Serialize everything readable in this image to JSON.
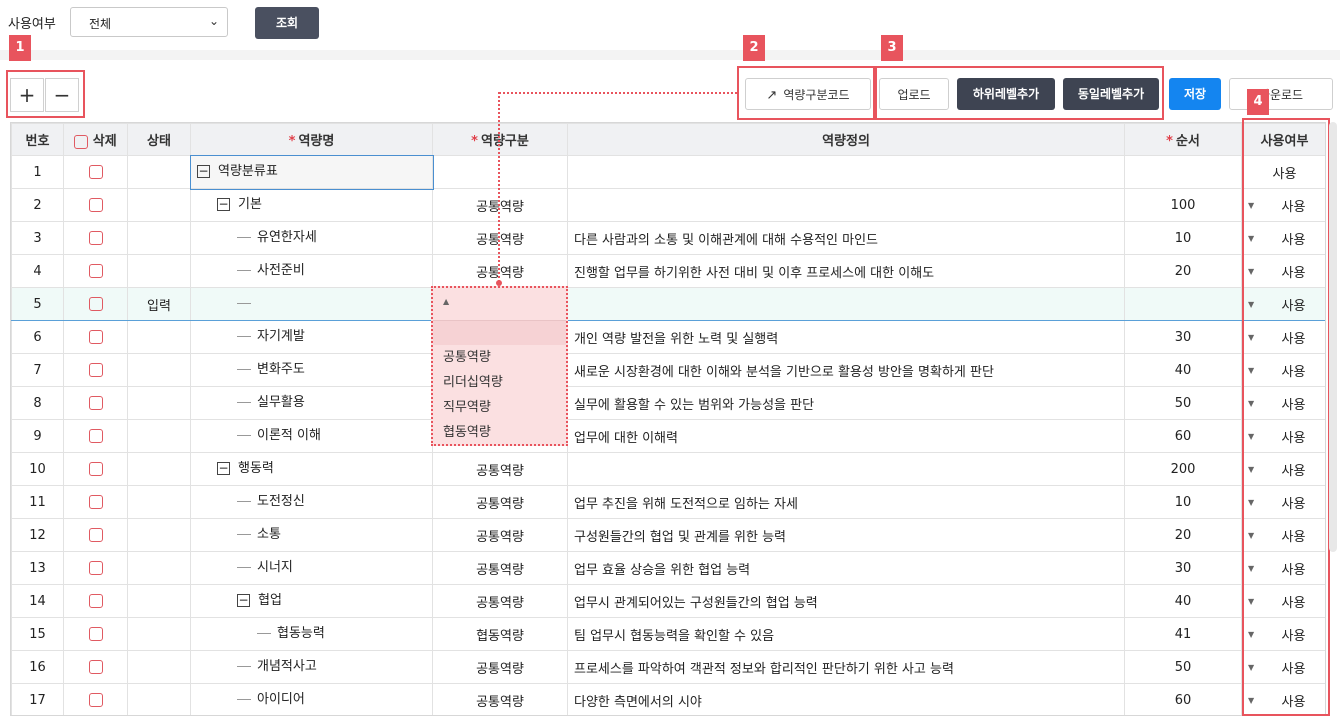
{
  "filter": {
    "label": "사용여부",
    "select_value": "전체",
    "search_label": "조회"
  },
  "toolbar": {
    "code_button": "역량구분코드",
    "upload": "업로드",
    "add_child": "하위레벨추가",
    "add_sibling": "동일레벨추가",
    "save": "저장",
    "download": "다운로드"
  },
  "badges": [
    "1",
    "2",
    "3",
    "4"
  ],
  "plus_minus": {
    "plus": "+",
    "minus": "−"
  },
  "columns": {
    "no": "번호",
    "delete": "삭제",
    "status": "상태",
    "name": "역량명",
    "category": "역량구분",
    "definition": "역량정의",
    "order": "순서",
    "use": "사용여부"
  },
  "rows": [
    {
      "no": "1",
      "status": "",
      "name": "역량분류표",
      "category": "",
      "definition": "",
      "order": "",
      "use": "사용"
    },
    {
      "no": "2",
      "status": "",
      "name": "기본",
      "category": "공통역량",
      "definition": "",
      "order": "100",
      "use": "사용"
    },
    {
      "no": "3",
      "status": "",
      "name": "유연한자세",
      "category": "공통역량",
      "definition": "다른 사람과의 소통 및 이해관계에 대해 수용적인 마인드",
      "order": "10",
      "use": "사용"
    },
    {
      "no": "4",
      "status": "",
      "name": "사전준비",
      "category": "공통역량",
      "definition": "진행할 업무를 하기위한 사전 대비 및 이후 프로세스에 대한 이해도",
      "order": "20",
      "use": "사용"
    },
    {
      "no": "5",
      "status": "입력",
      "name": "",
      "category": "",
      "definition": "",
      "order": "",
      "use": "사용"
    },
    {
      "no": "6",
      "status": "",
      "name": "자기계발",
      "category": "",
      "definition": "개인 역량 발전을 위한 노력 및 실행력",
      "order": "30",
      "use": "사용"
    },
    {
      "no": "7",
      "status": "",
      "name": "변화주도",
      "category": "",
      "definition": "새로운 시장환경에 대한 이해와 분석을 기반으로 활용성 방안을 명확하게 판단",
      "order": "40",
      "use": "사용"
    },
    {
      "no": "8",
      "status": "",
      "name": "실무활용",
      "category": "",
      "definition": "실무에 활용할 수 있는 범위와 가능성을 판단",
      "order": "50",
      "use": "사용"
    },
    {
      "no": "9",
      "status": "",
      "name": "이론적 이해",
      "category": "",
      "definition": "업무에 대한 이해력",
      "order": "60",
      "use": "사용"
    },
    {
      "no": "10",
      "status": "",
      "name": "행동력",
      "category": "공통역량",
      "definition": "",
      "order": "200",
      "use": "사용"
    },
    {
      "no": "11",
      "status": "",
      "name": "도전정신",
      "category": "공통역량",
      "definition": "업무 추진을 위해 도전적으로 임하는 자세",
      "order": "10",
      "use": "사용"
    },
    {
      "no": "12",
      "status": "",
      "name": "소통",
      "category": "공통역량",
      "definition": "구성원들간의 협업 및 관계를 위한 능력",
      "order": "20",
      "use": "사용"
    },
    {
      "no": "13",
      "status": "",
      "name": "시너지",
      "category": "공통역량",
      "definition": "업무 효율 상승을 위한 협업 능력",
      "order": "30",
      "use": "사용"
    },
    {
      "no": "14",
      "status": "",
      "name": "협업",
      "category": "공통역량",
      "definition": "업무시 관계되어있는 구성원들간의 협업 능력",
      "order": "40",
      "use": "사용"
    },
    {
      "no": "15",
      "status": "",
      "name": "협동능력",
      "category": "협동역량",
      "definition": "팀 업무시 협동능력을 확인할 수 있음",
      "order": "41",
      "use": "사용"
    },
    {
      "no": "16",
      "status": "",
      "name": "개념적사고",
      "category": "공통역량",
      "definition": "프로세스를 파악하여 객관적 정보와 합리적인 판단하기 위한 사고 능력",
      "order": "50",
      "use": "사용"
    },
    {
      "no": "17",
      "status": "",
      "name": "아이디어",
      "category": "공통역량",
      "definition": "다양한 측면에서의 시야",
      "order": "60",
      "use": "사용"
    }
  ],
  "dropdown_options": [
    "공통역량",
    "리더십역량",
    "직무역량",
    "협동역량"
  ],
  "colors": {
    "highlight": "#e8545d",
    "dark_button": "#3e4452",
    "save_button": "#1485f0"
  }
}
